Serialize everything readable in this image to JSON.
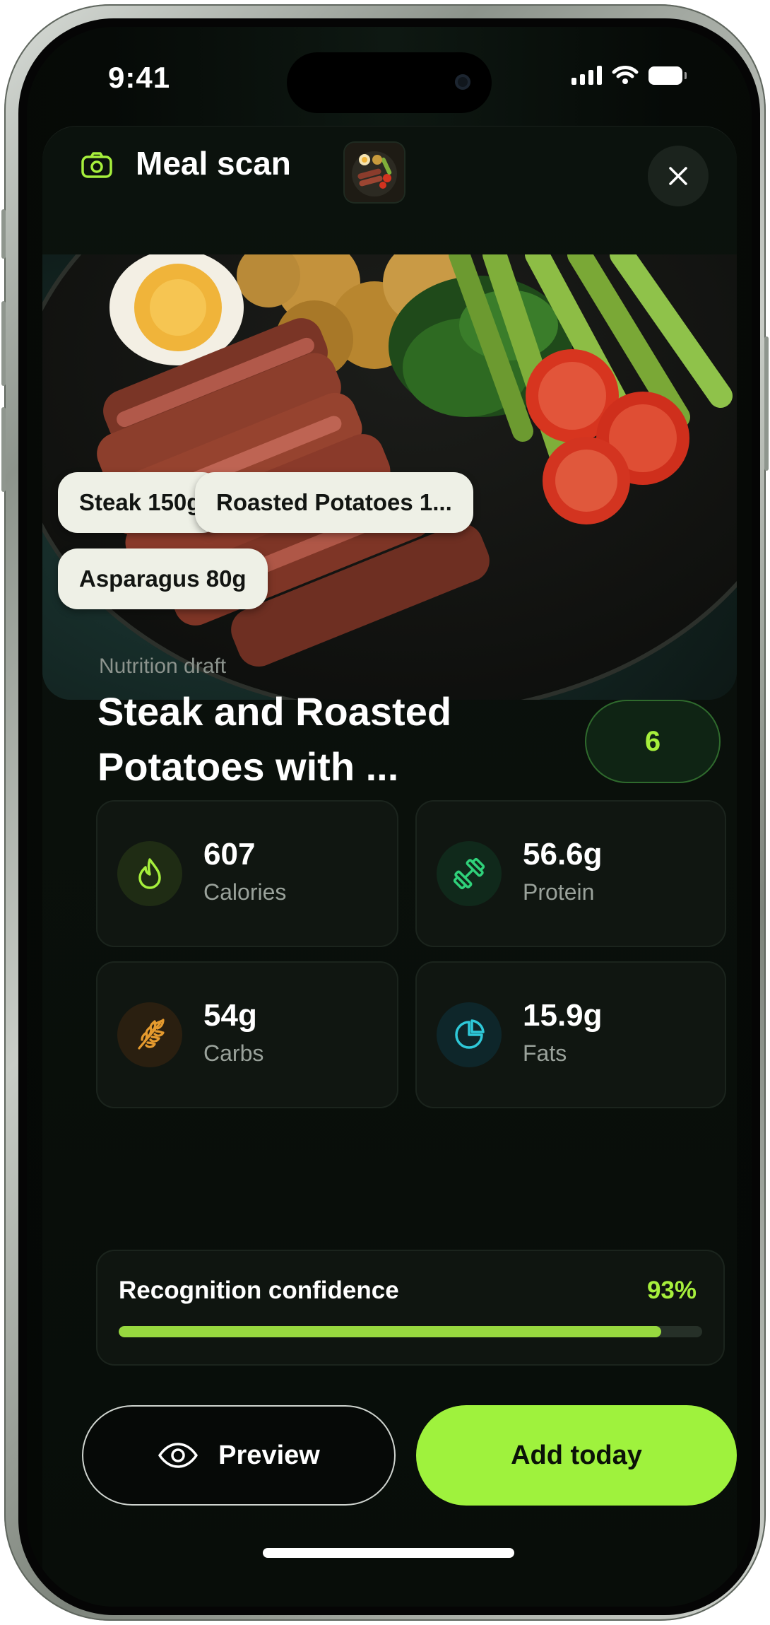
{
  "status_bar": {
    "time": "9:41"
  },
  "header": {
    "title": "Meal scan",
    "icons": {
      "camera": "camera-icon",
      "close": "close-icon"
    }
  },
  "photo": {
    "tags": [
      "Steak 150g",
      "Roasted Potatoes 1...",
      "Asparagus 80g"
    ]
  },
  "nutrition": {
    "eyebrow": "Nutrition draft",
    "title_line1": "Steak and Roasted",
    "title_line2": "Potatoes with ...",
    "score": "6",
    "metrics": [
      {
        "value": "607",
        "label": "Calories",
        "icon": "flame-icon",
        "color": "#a6ef3c"
      },
      {
        "value": "56.6g",
        "label": "Protein",
        "icon": "dumbbell-icon",
        "color": "#2fd17a"
      },
      {
        "value": "54g",
        "label": "Carbs",
        "icon": "wheat-icon",
        "color": "#e59a2e"
      },
      {
        "value": "15.9g",
        "label": "Fats",
        "icon": "pie-chart-icon",
        "color": "#2ec8d8"
      }
    ]
  },
  "confidence": {
    "label": "Recognition confidence",
    "value_text": "93%",
    "fraction": 0.93
  },
  "actions": {
    "preview_label": "Preview",
    "add_label": "Add today"
  },
  "colors": {
    "accent": "#9ff23d",
    "background": "#080d09"
  }
}
